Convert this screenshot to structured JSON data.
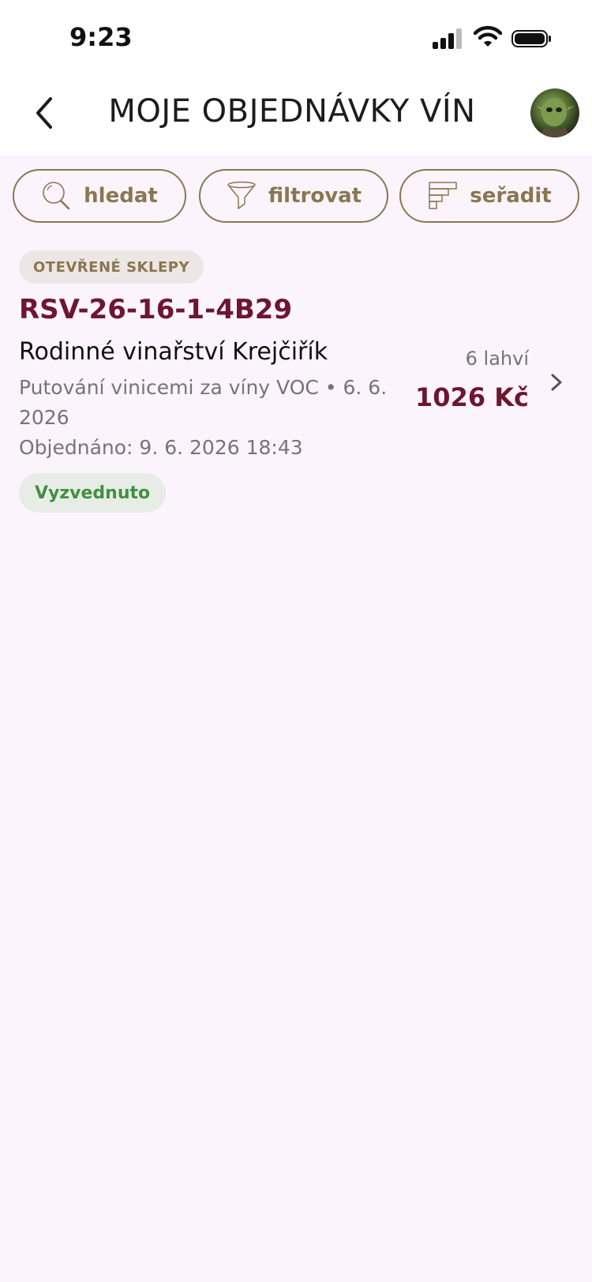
{
  "status_bar": {
    "time": "9:23",
    "icons": [
      "cellular-signal-icon",
      "wifi-icon",
      "battery-icon"
    ]
  },
  "header": {
    "title": "MOJE OBJEDNÁVKY VÍN",
    "back_icon": "chevron-left-icon",
    "avatar_icon": "user-avatar"
  },
  "toolbar": {
    "search_label": "hledat",
    "filter_label": "filtrovat",
    "sort_label": "seřadit",
    "icons": [
      "search-icon",
      "funnel-icon",
      "sort-icon"
    ]
  },
  "orders": [
    {
      "event_type": "OTEVŘENÉ SKLEPY",
      "code": "RSV-26-16-1-4B29",
      "winery": "Rodinné vinařství Krejčiřík",
      "event": "Putování vinicemi za víny VOC • 6. 6. 2026",
      "ordered_at": "Objednáno: 9. 6. 2026 18:43",
      "status": "Vyzvednuto",
      "bottles": "6 lahví",
      "price": "1026 Kč"
    }
  ],
  "colors": {
    "background": "#fcf4fc",
    "accent_gold": "#8a7650",
    "wine_red": "#6e1631",
    "status_green": "#3f9140",
    "muted_text": "#757575"
  }
}
